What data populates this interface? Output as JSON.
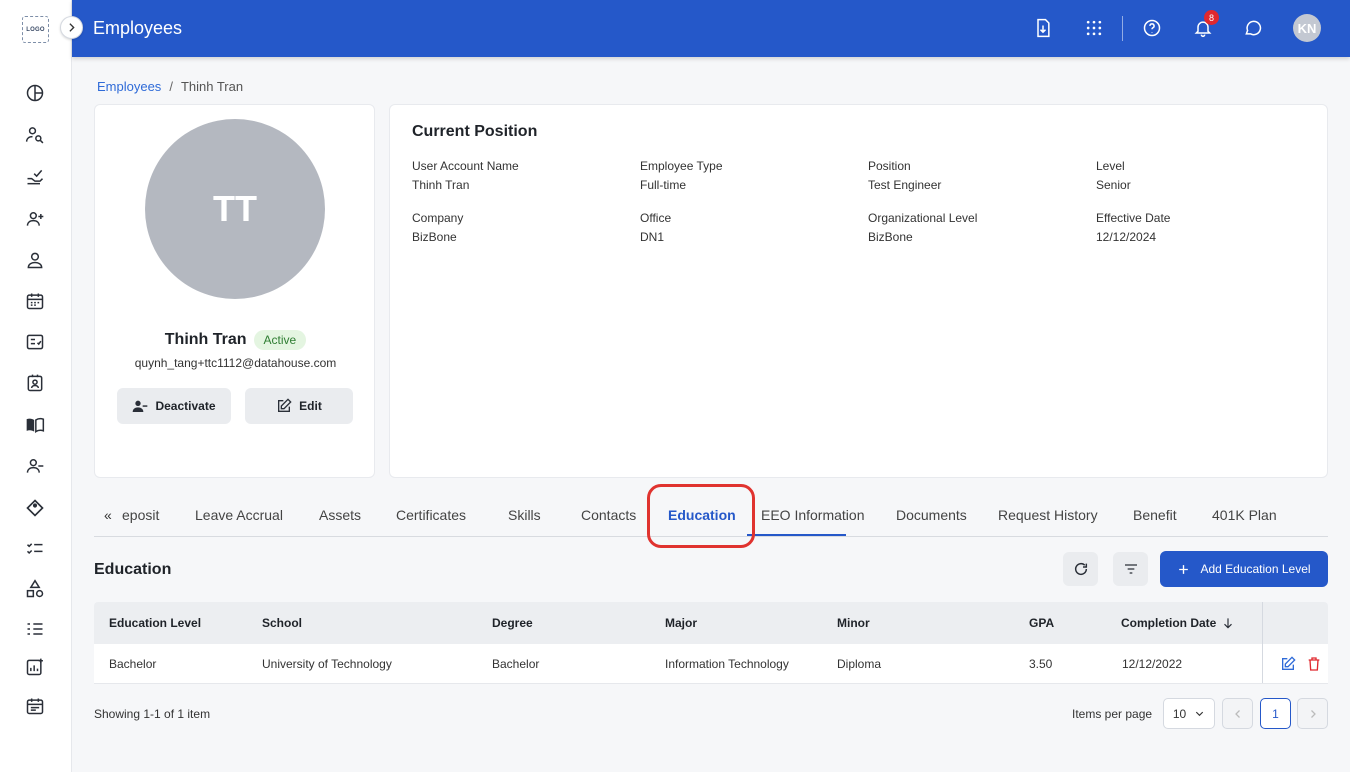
{
  "app": {
    "logo_text": "LOGO",
    "title": "Employees"
  },
  "header": {
    "notification_count": "8",
    "user_initials": "KN"
  },
  "breadcrumb": {
    "parent": "Employees",
    "separator": "/",
    "current": "Thinh Tran"
  },
  "profile": {
    "initials": "TT",
    "name": "Thinh Tran",
    "status": "Active",
    "email": "quynh_tang+ttc1112@datahouse.com",
    "deactivate_label": "Deactivate",
    "edit_label": "Edit"
  },
  "position": {
    "title": "Current Position",
    "fields": [
      {
        "label": "User Account Name",
        "value": "Thinh Tran"
      },
      {
        "label": "Employee Type",
        "value": "Full-time"
      },
      {
        "label": "Position",
        "value": "Test Engineer"
      },
      {
        "label": "Level",
        "value": "Senior"
      },
      {
        "label": "Company",
        "value": "BizBone"
      },
      {
        "label": "Office",
        "value": "DN1"
      },
      {
        "label": "Organizational Level",
        "value": "BizBone"
      },
      {
        "label": "Effective Date",
        "value": "12/12/2024"
      }
    ]
  },
  "tabs": {
    "scroll_left": "«",
    "items": [
      {
        "label": "eposit"
      },
      {
        "label": "Leave Accrual"
      },
      {
        "label": "Assets"
      },
      {
        "label": "Certificates"
      },
      {
        "label": "Skills"
      },
      {
        "label": "Contacts"
      },
      {
        "label": "Education"
      },
      {
        "label": "EEO Information"
      },
      {
        "label": "Documents"
      },
      {
        "label": "Request History"
      },
      {
        "label": "Benefit"
      },
      {
        "label": "401K Plan"
      }
    ],
    "active": "Education"
  },
  "education": {
    "title": "Education",
    "add_label": "Add Education Level",
    "columns": [
      "Education Level",
      "School",
      "Degree",
      "Major",
      "Minor",
      "GPA",
      "Completion Date"
    ],
    "rows": [
      [
        "Bachelor",
        "University of Technology",
        "Bachelor",
        "Information Technology",
        "Diploma",
        "3.50",
        "12/12/2022"
      ]
    ],
    "showing": "Showing 1-1 of 1 item",
    "items_per_page_label": "Items per page",
    "items_per_page": "10",
    "current_page": "1"
  },
  "colors": {
    "primary": "#2558c9",
    "highlight": "#e0332f",
    "active_badge_bg": "#e4f5e1",
    "danger": "#e0282e"
  }
}
